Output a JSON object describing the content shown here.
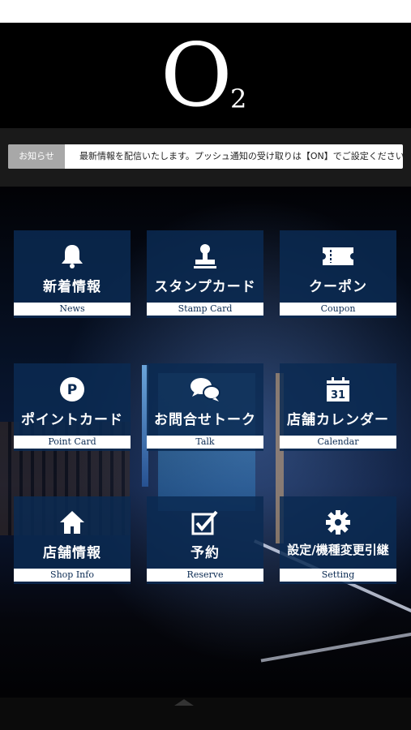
{
  "header": {
    "logo_main": "O",
    "logo_sub": "2"
  },
  "news": {
    "label": "お知らせ",
    "text": "最新情報を配信いたします。プッシュ通知の受け取りは【ON】でご設定ください。"
  },
  "menu": [
    {
      "jp": "新着情報",
      "en": "News",
      "icon": "bell-icon"
    },
    {
      "jp": "スタンプカード",
      "en": "Stamp Card",
      "icon": "stamp-icon"
    },
    {
      "jp": "クーポン",
      "en": "Coupon",
      "icon": "ticket-icon"
    },
    {
      "jp": "ポイントカード",
      "en": "Point Card",
      "icon": "point-icon"
    },
    {
      "jp": "お問合せトーク",
      "en": "Talk",
      "icon": "chat-icon"
    },
    {
      "jp": "店舗カレンダー",
      "en": "Calendar",
      "icon": "calendar-icon",
      "calendar_day": "31"
    },
    {
      "jp": "店舗情報",
      "en": "Shop Info",
      "icon": "home-icon"
    },
    {
      "jp": "予約",
      "en": "Reserve",
      "icon": "checkbox-icon"
    },
    {
      "jp": "設定/機種変更引継",
      "en": "Setting",
      "icon": "gear-icon"
    }
  ],
  "colors": {
    "tile": "#0a2a52",
    "accent": "#ffffff"
  }
}
